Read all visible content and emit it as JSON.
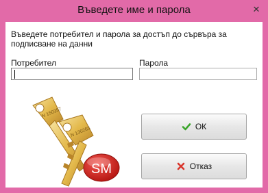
{
  "window": {
    "title": "Въведете име и парола",
    "close_glyph": "✕"
  },
  "prompt": {
    "description": "Въведете потребител и парола за достъп до сървъра за подписване на данни"
  },
  "fields": {
    "user_label": "Потребител",
    "user_value": "",
    "password_label": "Парола",
    "password_value": ""
  },
  "buttons": {
    "ok_label": "ОК",
    "cancel_label": "Отказ"
  },
  "logo": {
    "badge_text": "SM",
    "key1_serial": "N 150397",
    "key2_serial": "N 130263"
  },
  "colors": {
    "frame": "#e26aa8",
    "ok_icon": "#3aa52a",
    "cancel_icon": "#d9352b",
    "badge": "#d6201e",
    "key_gold": "#e3b84a"
  },
  "icons": {
    "ok": "check-icon",
    "cancel": "x-icon"
  }
}
